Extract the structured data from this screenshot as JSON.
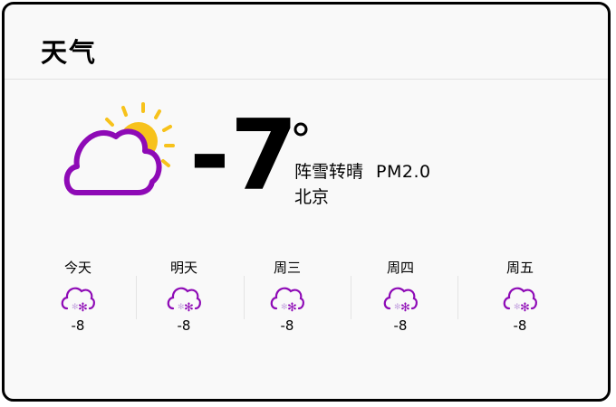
{
  "app": {
    "title": "天气"
  },
  "current": {
    "temperature": "-7",
    "condition": "阵雪转晴",
    "air_quality": "PM2.0",
    "city": "北京",
    "icon": "cloud-sun-icon"
  },
  "forecast": [
    {
      "day": "今天",
      "temp": "-8",
      "icon": "snow-cloud-icon"
    },
    {
      "day": "明天",
      "temp": "-8",
      "icon": "snow-cloud-icon"
    },
    {
      "day": "周三",
      "temp": "-8",
      "icon": "snow-cloud-icon"
    },
    {
      "day": "周四",
      "temp": "-8",
      "icon": "snow-cloud-icon"
    },
    {
      "day": "周五",
      "temp": "-8",
      "icon": "snow-cloud-icon"
    }
  ],
  "colors": {
    "cloud": "#8e0ab6",
    "sun": "#f7c21b",
    "border": "#000000",
    "background": "#f9f9f9"
  }
}
